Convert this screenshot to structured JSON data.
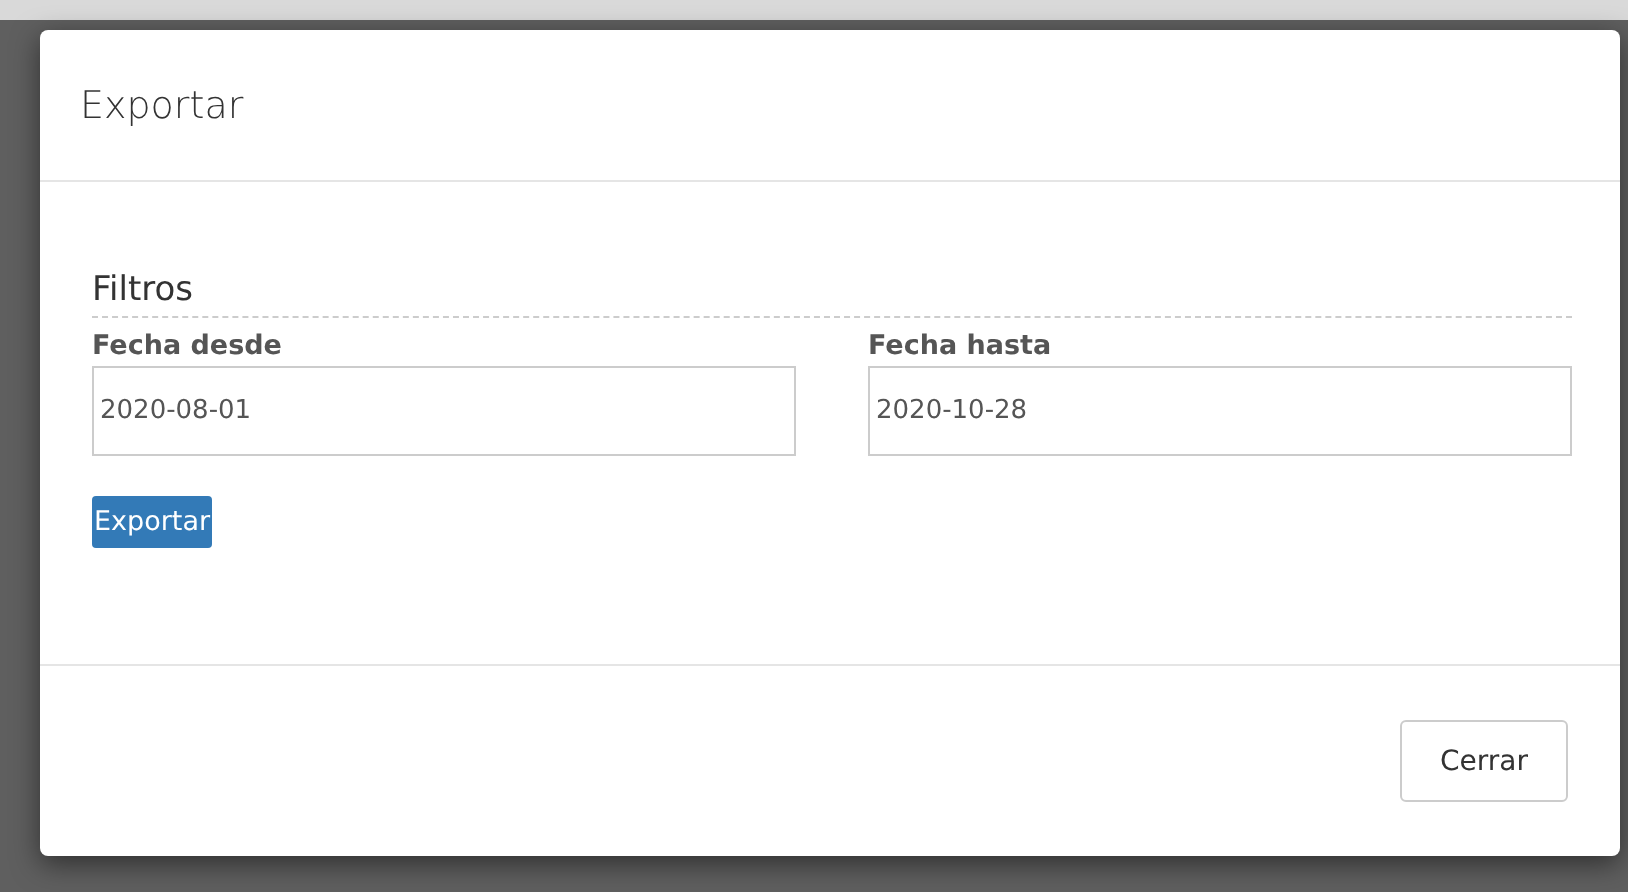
{
  "modal": {
    "title": "Exportar",
    "section_title": "Filtros",
    "fields": [
      {
        "label": "Fecha desde",
        "value": "2020-08-01"
      },
      {
        "label": "Fecha hasta",
        "value": "2020-10-28"
      }
    ],
    "export_button": "Exportar",
    "close_button": "Cerrar"
  }
}
